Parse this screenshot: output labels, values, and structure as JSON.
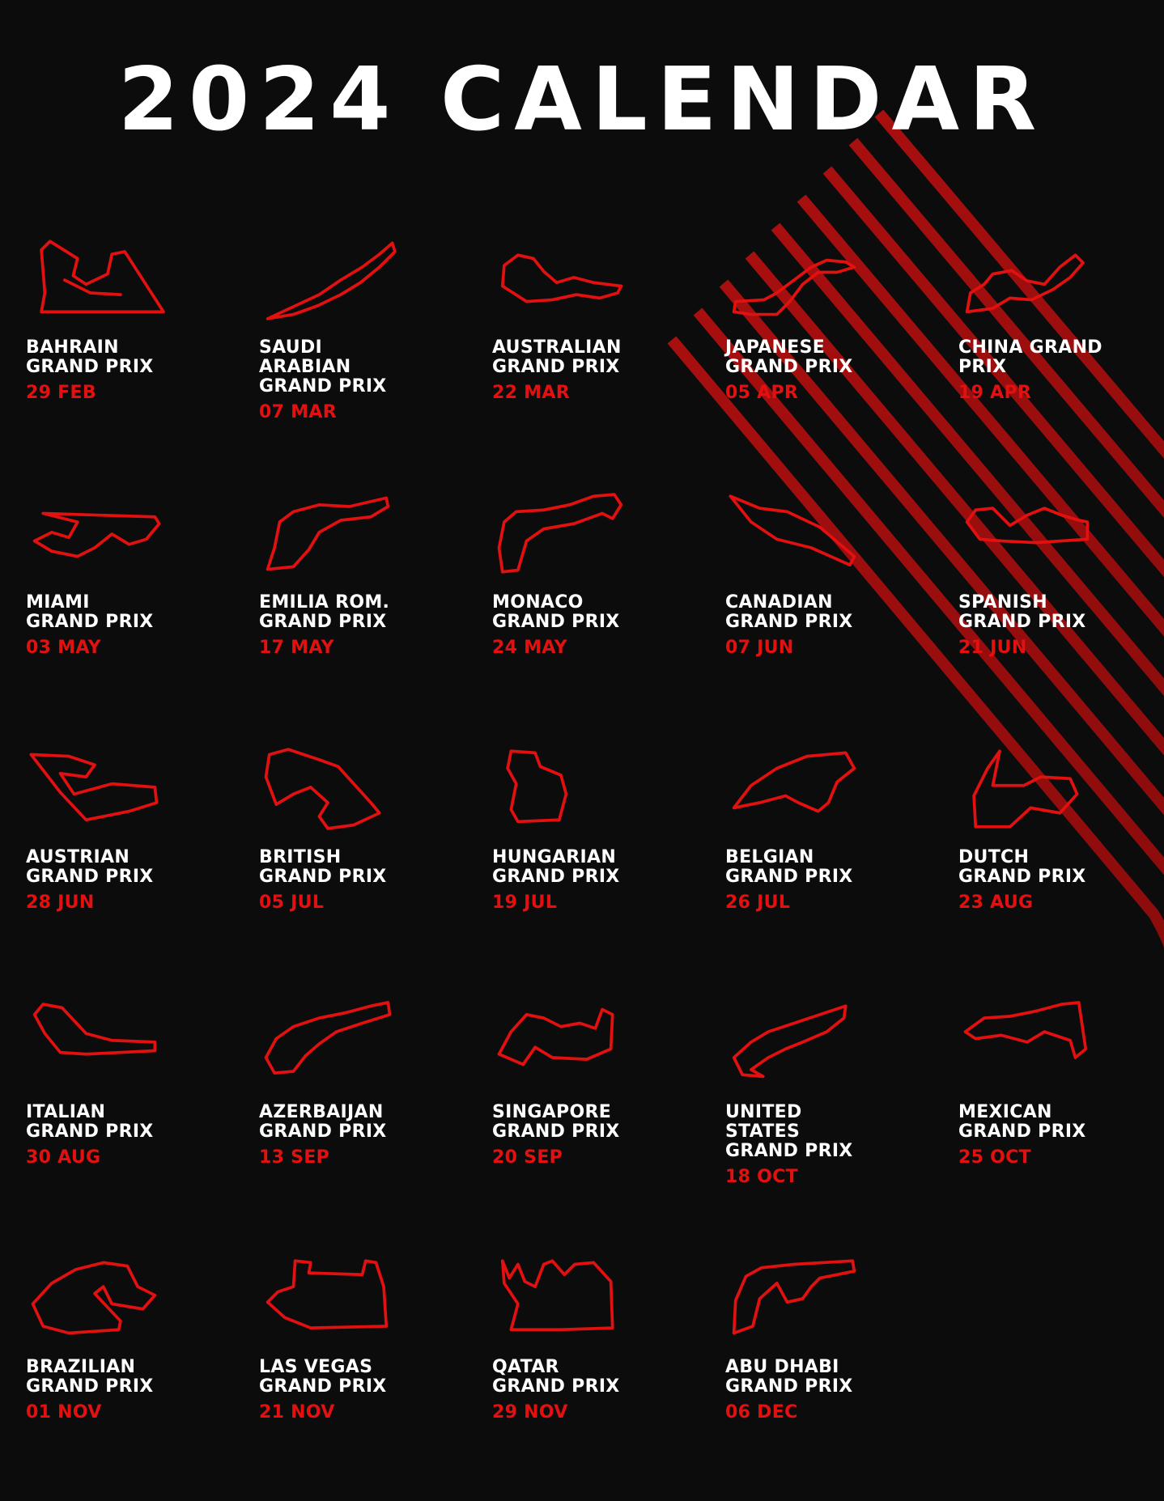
{
  "title": "2024 CALENDAR",
  "colors": {
    "background": "#0c0c0d",
    "text": "#ffffff",
    "accent": "#e31010"
  },
  "races": [
    {
      "name": "BAHRAIN\nGRAND PRIX",
      "date": "29 FEB",
      "icon": "bahrain-circuit-icon"
    },
    {
      "name": "SAUDI\nARABIAN\nGRAND PRIX",
      "date": "07 MAR",
      "icon": "jeddah-circuit-icon"
    },
    {
      "name": "AUSTRALIAN\nGRAND PRIX",
      "date": "22 MAR",
      "icon": "albert-park-circuit-icon"
    },
    {
      "name": "JAPANESE\nGRAND PRIX",
      "date": "05 APR",
      "icon": "suzuka-circuit-icon"
    },
    {
      "name": "CHINA GRAND\nPRIX",
      "date": "19 APR",
      "icon": "shanghai-circuit-icon"
    },
    {
      "name": "MIAMI\nGRAND PRIX",
      "date": "03 MAY",
      "icon": "miami-circuit-icon"
    },
    {
      "name": "EMILIA ROM.\nGRAND PRIX",
      "date": "17 MAY",
      "icon": "imola-circuit-icon"
    },
    {
      "name": "MONACO\nGRAND PRIX",
      "date": "24 MAY",
      "icon": "monaco-circuit-icon"
    },
    {
      "name": "CANADIAN\nGRAND PRIX",
      "date": "07 JUN",
      "icon": "montreal-circuit-icon"
    },
    {
      "name": "SPANISH\nGRAND PRIX",
      "date": "21 JUN",
      "icon": "barcelona-circuit-icon"
    },
    {
      "name": "AUSTRIAN\nGRAND PRIX",
      "date": "28 JUN",
      "icon": "red-bull-ring-circuit-icon"
    },
    {
      "name": "BRITISH\nGRAND PRIX",
      "date": "05 JUL",
      "icon": "silverstone-circuit-icon"
    },
    {
      "name": "HUNGARIAN\nGRAND PRIX",
      "date": "19 JUL",
      "icon": "hungaroring-circuit-icon"
    },
    {
      "name": "BELGIAN\nGRAND PRIX",
      "date": "26 JUL",
      "icon": "spa-circuit-icon"
    },
    {
      "name": "DUTCH\nGRAND PRIX",
      "date": "23 AUG",
      "icon": "zandvoort-circuit-icon"
    },
    {
      "name": "ITALIAN\nGRAND PRIX",
      "date": "30 AUG",
      "icon": "monza-circuit-icon"
    },
    {
      "name": "AZERBAIJAN\nGRAND PRIX",
      "date": "13 SEP",
      "icon": "baku-circuit-icon"
    },
    {
      "name": "SINGAPORE\nGRAND PRIX",
      "date": "20 SEP",
      "icon": "marina-bay-circuit-icon"
    },
    {
      "name": "UNITED\nSTATES\nGRAND PRIX",
      "date": "18 OCT",
      "icon": "cota-circuit-icon"
    },
    {
      "name": "MEXICAN\nGRAND PRIX",
      "date": "25 OCT",
      "icon": "mexico-city-circuit-icon"
    },
    {
      "name": "BRAZILIAN\nGRAND PRIX",
      "date": "01 NOV",
      "icon": "interlagos-circuit-icon"
    },
    {
      "name": "LAS VEGAS\nGRAND PRIX",
      "date": "21 NOV",
      "icon": "las-vegas-circuit-icon"
    },
    {
      "name": "QATAR\nGRAND PRIX",
      "date": "29 NOV",
      "icon": "lusail-circuit-icon"
    },
    {
      "name": "ABU DHABI\nGRAND PRIX",
      "date": "06 DEC",
      "icon": "yas-marina-circuit-icon"
    }
  ]
}
